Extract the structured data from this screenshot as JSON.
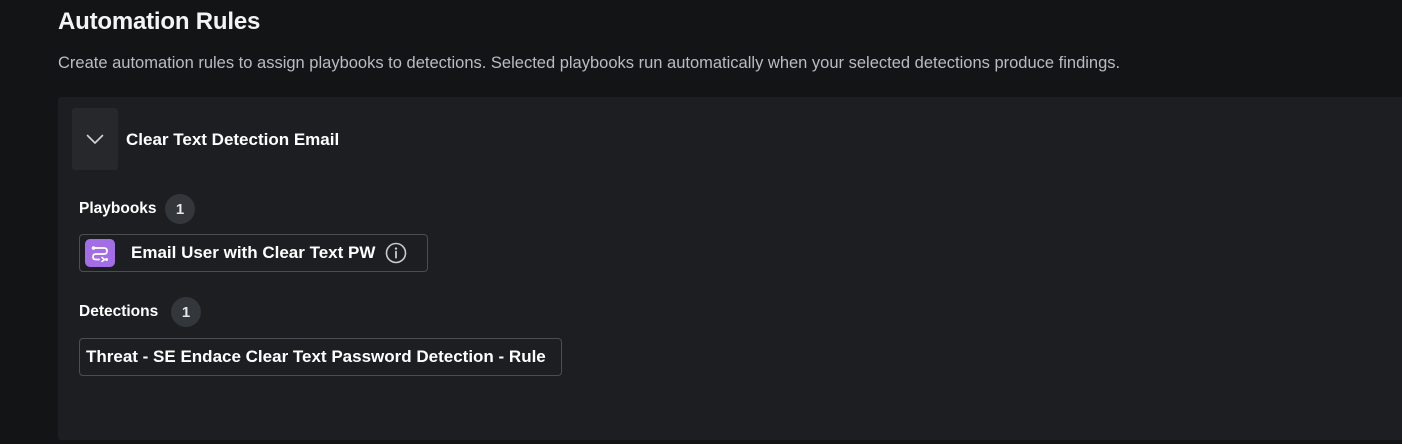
{
  "header": {
    "title": "Automation Rules",
    "subtitle": "Create automation rules to assign playbooks to detections. Selected playbooks run automatically when your selected detections produce findings."
  },
  "rule": {
    "name": "Clear Text Detection Email",
    "toggle_icon": "chevron-down-icon",
    "playbooks": {
      "label": "Playbooks",
      "count": "1",
      "items": [
        {
          "label": "Email User with Clear Text PW",
          "icon": "playbook-icon",
          "icon_color": "#a36ee5",
          "info_icon": "info-icon"
        }
      ]
    },
    "detections": {
      "label": "Detections",
      "count": "1",
      "items": [
        {
          "label": "Threat - SE Endace Clear Text Password Detection - Rule"
        }
      ]
    }
  },
  "colors": {
    "background": "#131416",
    "card": "#1d1e21",
    "badge": "#33363b",
    "accent_purple": "#a36ee5"
  }
}
